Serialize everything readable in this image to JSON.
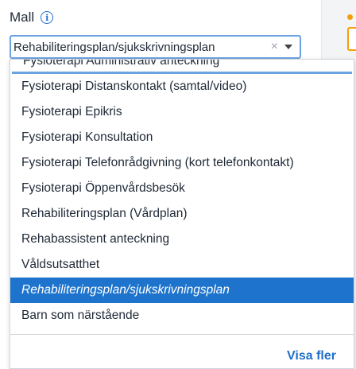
{
  "field": {
    "label": "Mall",
    "info_icon": "info-icon"
  },
  "select": {
    "value": "Rehabiliteringsplan/sjukskrivningsplan",
    "clear_icon": "×"
  },
  "dropdown": {
    "options": [
      {
        "label": "Fysioterapi Administrativ anteckning",
        "selected": false
      },
      {
        "label": "Fysioterapi Distanskontakt (samtal/video)",
        "selected": false
      },
      {
        "label": "Fysioterapi Epikris",
        "selected": false
      },
      {
        "label": "Fysioterapi Konsultation",
        "selected": false
      },
      {
        "label": "Fysioterapi Telefonrådgivning (kort telefonkontakt)",
        "selected": false
      },
      {
        "label": "Fysioterapi Öppenvårdsbesök",
        "selected": false
      },
      {
        "label": "Rehabiliteringsplan (Vårdplan)",
        "selected": false
      },
      {
        "label": "Rehabassistent anteckning",
        "selected": false
      },
      {
        "label": "Våldsutsatthet",
        "selected": false
      },
      {
        "label": "Rehabiliteringsplan/sjukskrivningsplan",
        "selected": true
      },
      {
        "label": "Barn som närstående",
        "selected": false
      }
    ],
    "show_more": "Visa fler"
  },
  "colors": {
    "accent": "#1e74cc",
    "focus_border": "#6aa3e0",
    "warning": "#f59e0b"
  }
}
